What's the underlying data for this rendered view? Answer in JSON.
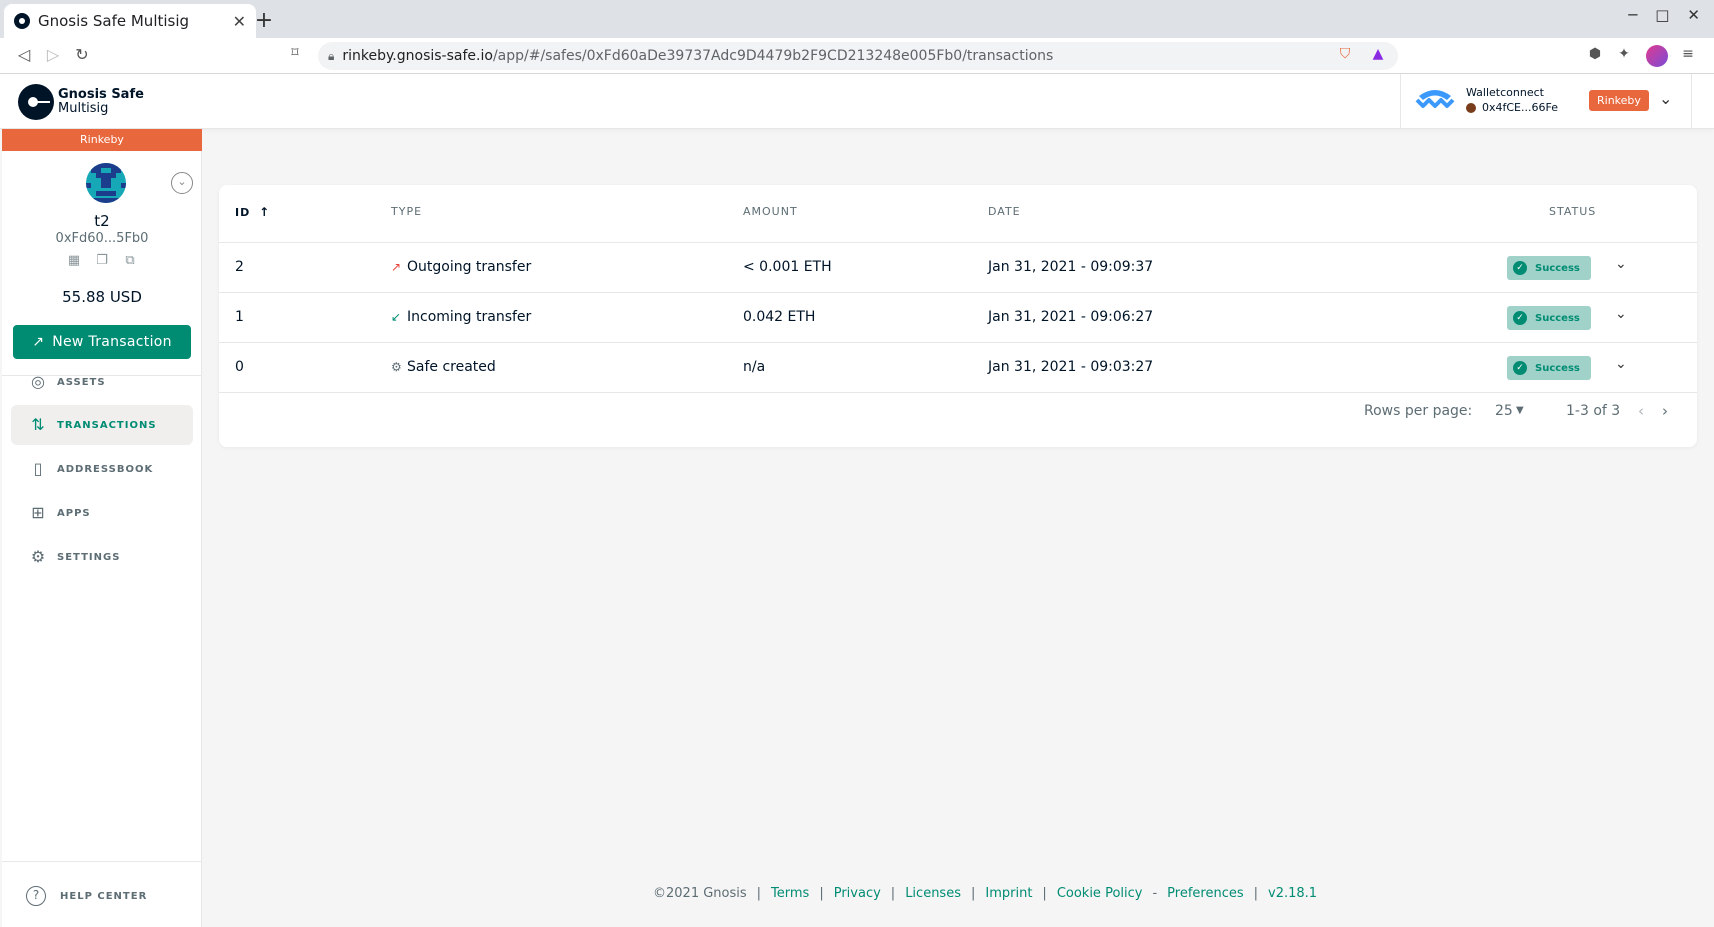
{
  "browser": {
    "tab_title": "Gnosis Safe Multisig",
    "url_host": "rinkeby.gnosis-safe.io",
    "url_path": "/app/#/safes/0xFd60aDe39737Adc9D4479b2F9CD213248e005Fb0/transactions"
  },
  "header": {
    "logo_line1": "Gnosis Safe",
    "logo_line2": "Multisig",
    "wallet_name": "Walletconnect",
    "wallet_address": "0x4fCE...66Fe",
    "network": "Rinkeby"
  },
  "sidebar": {
    "network": "Rinkeby",
    "safe_name": "t2",
    "safe_address": "0xFd60...5Fb0",
    "balance": "55.88 USD",
    "new_tx_label": "New Transaction",
    "nav": [
      {
        "label": "ASSETS",
        "icon": "assets-icon"
      },
      {
        "label": "TRANSACTIONS",
        "icon": "transactions-icon"
      },
      {
        "label": "ADDRESSBOOK",
        "icon": "addressbook-icon"
      },
      {
        "label": "APPS",
        "icon": "apps-icon"
      },
      {
        "label": "SETTINGS",
        "icon": "settings-icon"
      }
    ],
    "help": "HELP CENTER"
  },
  "table": {
    "headers": {
      "id": "ID",
      "type": "TYPE",
      "amount": "AMOUNT",
      "date": "DATE",
      "status": "STATUS"
    },
    "rows": [
      {
        "id": "2",
        "type": "Outgoing transfer",
        "type_icon": "outgoing-arrow-icon",
        "amount": "< 0.001 ETH",
        "date": "Jan 31, 2021 - 09:09:37",
        "status": "Success"
      },
      {
        "id": "1",
        "type": "Incoming transfer",
        "type_icon": "incoming-arrow-icon",
        "amount": "0.042 ETH",
        "date": "Jan 31, 2021 - 09:06:27",
        "status": "Success"
      },
      {
        "id": "0",
        "type": "Safe created",
        "type_icon": "gear-icon",
        "amount": "n/a",
        "date": "Jan 31, 2021 - 09:03:27",
        "status": "Success"
      }
    ],
    "rows_per_page_label": "Rows per page:",
    "rows_per_page": "25",
    "range": "1-3 of 3"
  },
  "footer": {
    "copyright": "©2021 Gnosis",
    "links": [
      "Terms",
      "Privacy",
      "Licenses",
      "Imprint",
      "Cookie Policy",
      "Preferences",
      "v2.18.1"
    ]
  },
  "colors": {
    "accent": "#008c73",
    "network": "#e8673c",
    "status_bg": "#a1d2ca"
  }
}
